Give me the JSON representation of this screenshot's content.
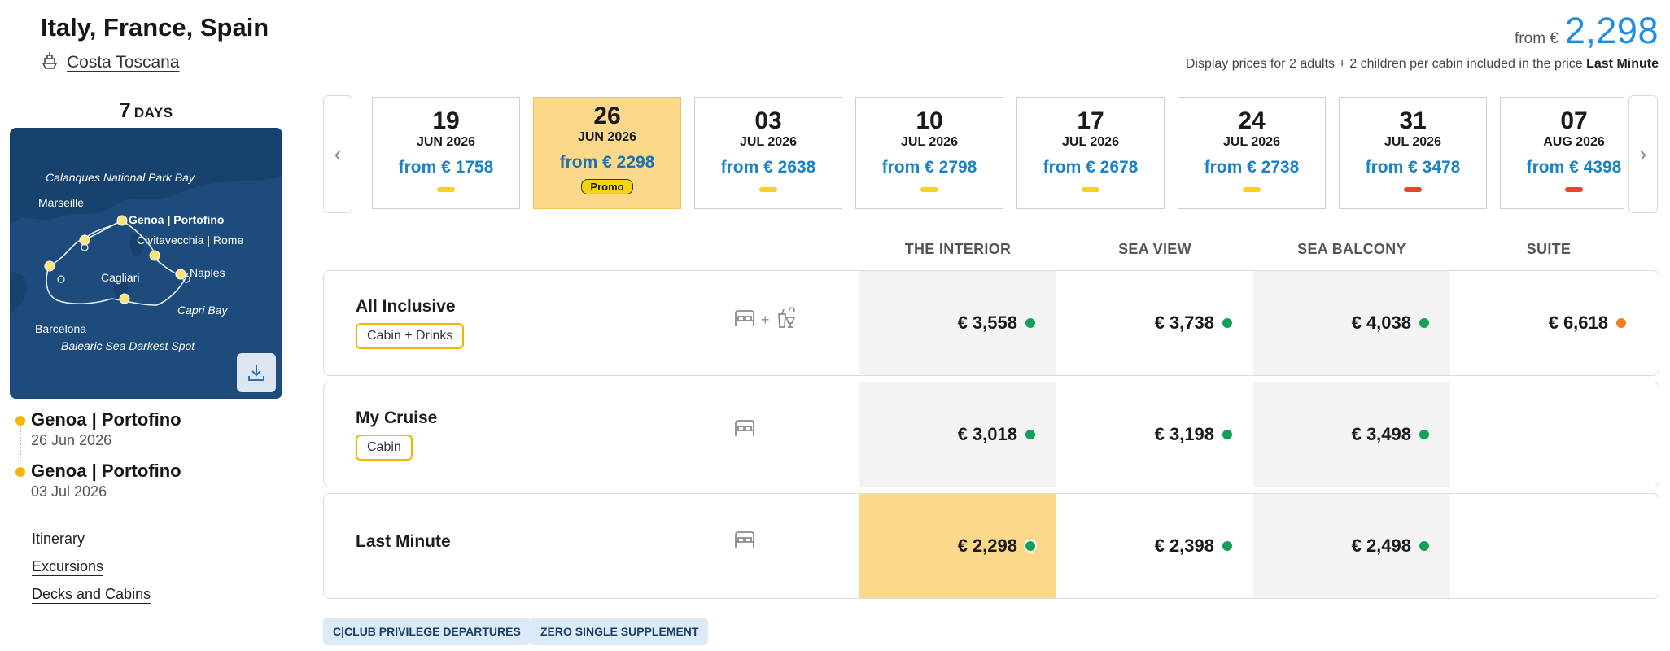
{
  "header": {
    "title": "Italy, France, Spain",
    "ship": "Costa Toscana",
    "price_from_label": "from €",
    "price_from_value": "2,298",
    "price_note": "Display prices for 2 adults + 2 children per cabin included in the price",
    "price_note_bold": "Last Minute"
  },
  "duration": {
    "number": "7",
    "unit": "DAYS"
  },
  "map_labels": {
    "calanques": "Calanques National Park Bay",
    "marseille": "Marseille",
    "genoa": "Genoa | Portofino",
    "civitavecchia": "Civitavecchia | Rome",
    "naples": "Naples",
    "cagliari": "Cagliari",
    "capri": "Capri Bay",
    "barcelona": "Barcelona",
    "balearic": "Balearic Sea Darkest Spot"
  },
  "itinerary": {
    "departure": {
      "port": "Genoa | Portofino",
      "date": "26 Jun 2026"
    },
    "arrival": {
      "port": "Genoa | Portofino",
      "date": "03 Jul 2026"
    }
  },
  "side_links": [
    "Itinerary",
    "Excursions",
    "Decks and Cabins"
  ],
  "dates": [
    {
      "day": "19",
      "month": "JUN 2026",
      "price": "from € 1758",
      "status": "yellow",
      "bar_color": "#f6d21a"
    },
    {
      "day": "26",
      "month": "JUN 2026",
      "price": "from € 2298",
      "status": "promo",
      "badge": "Promo",
      "active": true
    },
    {
      "day": "03",
      "month": "JUL 2026",
      "price": "from € 2638",
      "status": "yellow",
      "bar_color": "#f6d21a"
    },
    {
      "day": "10",
      "month": "JUL 2026",
      "price": "from € 2798",
      "status": "yellow",
      "bar_color": "#f6d21a"
    },
    {
      "day": "17",
      "month": "JUL 2026",
      "price": "from € 2678",
      "status": "yellow",
      "bar_color": "#f6d21a"
    },
    {
      "day": "24",
      "month": "JUL 2026",
      "price": "from € 2738",
      "status": "yellow",
      "bar_color": "#f6d21a"
    },
    {
      "day": "31",
      "month": "JUL 2026",
      "price": "from € 3478",
      "status": "red",
      "bar_color": "#e9432e"
    },
    {
      "day": "07",
      "month": "AUG 2026",
      "price": "from € 4398",
      "status": "red",
      "bar_color": "#e9432e"
    }
  ],
  "cabin_headers": [
    "THE INTERIOR",
    "SEA VIEW",
    "SEA BALCONY",
    "SUITE"
  ],
  "rates": [
    {
      "name": "All Inclusive",
      "tag": "Cabin + Drinks",
      "icon_plus": "+",
      "prices": [
        {
          "value": "€ 3,558",
          "dot": "#15a05a"
        },
        {
          "value": "€ 3,738",
          "dot": "#15a05a"
        },
        {
          "value": "€ 4,038",
          "dot": "#15a05a"
        },
        {
          "value": "€ 6,618",
          "dot": "#f27c1e"
        }
      ]
    },
    {
      "name": "My Cruise",
      "tag": "Cabin",
      "prices": [
        {
          "value": "€ 3,018",
          "dot": "#15a05a"
        },
        {
          "value": "€ 3,198",
          "dot": "#15a05a"
        },
        {
          "value": "€ 3,498",
          "dot": "#15a05a"
        }
      ]
    },
    {
      "name": "Last Minute",
      "prices": [
        {
          "value": "€ 2,298",
          "dot": "#15a05a",
          "selected": true
        },
        {
          "value": "€ 2,398",
          "dot": "#15a05a"
        },
        {
          "value": "€ 2,498",
          "dot": "#15a05a"
        }
      ]
    }
  ],
  "badges": [
    "C|CLUB PRIVILEGE DEPARTURES",
    "ZERO SINGLE SUPPLEMENT"
  ],
  "colors": {
    "accent_blue": "#1f8ee0",
    "highlight_yellow": "#fcd98a",
    "available_green": "#15a05a",
    "limited_orange": "#f27c1e"
  }
}
